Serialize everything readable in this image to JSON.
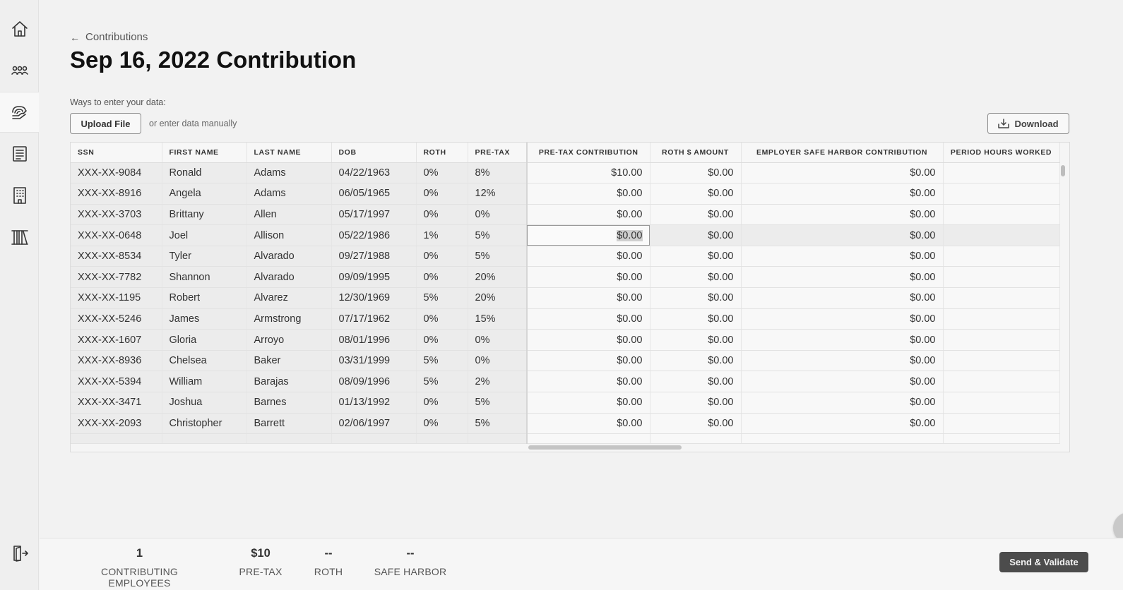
{
  "sidebar": {
    "items": [
      {
        "name": "home-icon"
      },
      {
        "name": "people-icon"
      },
      {
        "name": "contributions-icon"
      },
      {
        "name": "documents-icon"
      },
      {
        "name": "building-icon"
      },
      {
        "name": "library-icon"
      }
    ],
    "logout_icon": "logout-icon"
  },
  "breadcrumb": {
    "arrow": "←",
    "label": "Contributions"
  },
  "page_title": "Sep 16, 2022 Contribution",
  "entry": {
    "ways_label": "Ways to enter your data:",
    "upload_label": "Upload File",
    "manual_label": "or enter data manually",
    "download_label": "Download"
  },
  "table": {
    "headers": [
      "SSN",
      "FIRST NAME",
      "LAST NAME",
      "DOB",
      "ROTH",
      "PRE-TAX",
      "PRE-TAX CONTRIBUTION",
      "ROTH $ AMOUNT",
      "EMPLOYER SAFE HARBOR CONTRIBUTION",
      "PERIOD HOURS WORKED"
    ],
    "rows": [
      [
        "XXX-XX-9084",
        "Ronald",
        "Adams",
        "04/22/1963",
        "0%",
        "8%",
        "$10.00",
        "$0.00",
        "$0.00",
        ""
      ],
      [
        "XXX-XX-8916",
        "Angela",
        "Adams",
        "06/05/1965",
        "0%",
        "12%",
        "$0.00",
        "$0.00",
        "$0.00",
        ""
      ],
      [
        "XXX-XX-3703",
        "Brittany",
        "Allen",
        "05/17/1997",
        "0%",
        "0%",
        "$0.00",
        "$0.00",
        "$0.00",
        ""
      ],
      [
        "XXX-XX-0648",
        "Joel",
        "Allison",
        "05/22/1986",
        "1%",
        "5%",
        "$0.00",
        "$0.00",
        "$0.00",
        ""
      ],
      [
        "XXX-XX-8534",
        "Tyler",
        "Alvarado",
        "09/27/1988",
        "0%",
        "5%",
        "$0.00",
        "$0.00",
        "$0.00",
        ""
      ],
      [
        "XXX-XX-7782",
        "Shannon",
        "Alvarado",
        "09/09/1995",
        "0%",
        "20%",
        "$0.00",
        "$0.00",
        "$0.00",
        ""
      ],
      [
        "XXX-XX-1195",
        "Robert",
        "Alvarez",
        "12/30/1969",
        "5%",
        "20%",
        "$0.00",
        "$0.00",
        "$0.00",
        ""
      ],
      [
        "XXX-XX-5246",
        "James",
        "Armstrong",
        "07/17/1962",
        "0%",
        "15%",
        "$0.00",
        "$0.00",
        "$0.00",
        ""
      ],
      [
        "XXX-XX-1607",
        "Gloria",
        "Arroyo",
        "08/01/1996",
        "0%",
        "0%",
        "$0.00",
        "$0.00",
        "$0.00",
        ""
      ],
      [
        "XXX-XX-8936",
        "Chelsea",
        "Baker",
        "03/31/1999",
        "5%",
        "0%",
        "$0.00",
        "$0.00",
        "$0.00",
        ""
      ],
      [
        "XXX-XX-5394",
        "William",
        "Barajas",
        "08/09/1996",
        "5%",
        "2%",
        "$0.00",
        "$0.00",
        "$0.00",
        ""
      ],
      [
        "XXX-XX-3471",
        "Joshua",
        "Barnes",
        "01/13/1992",
        "0%",
        "5%",
        "$0.00",
        "$0.00",
        "$0.00",
        ""
      ],
      [
        "XXX-XX-2093",
        "Christopher",
        "Barrett",
        "02/06/1997",
        "0%",
        "5%",
        "$0.00",
        "$0.00",
        "$0.00",
        ""
      ]
    ],
    "highlighted_row": 3
  },
  "help_label": "?",
  "footer": {
    "stats": [
      {
        "value": "1",
        "label": "CONTRIBUTING EMPLOYEES"
      },
      {
        "value": "$10",
        "label": "PRE-TAX"
      },
      {
        "value": "--",
        "label": "ROTH"
      },
      {
        "value": "--",
        "label": "SAFE HARBOR"
      }
    ],
    "send_label": "Send & Validate"
  }
}
